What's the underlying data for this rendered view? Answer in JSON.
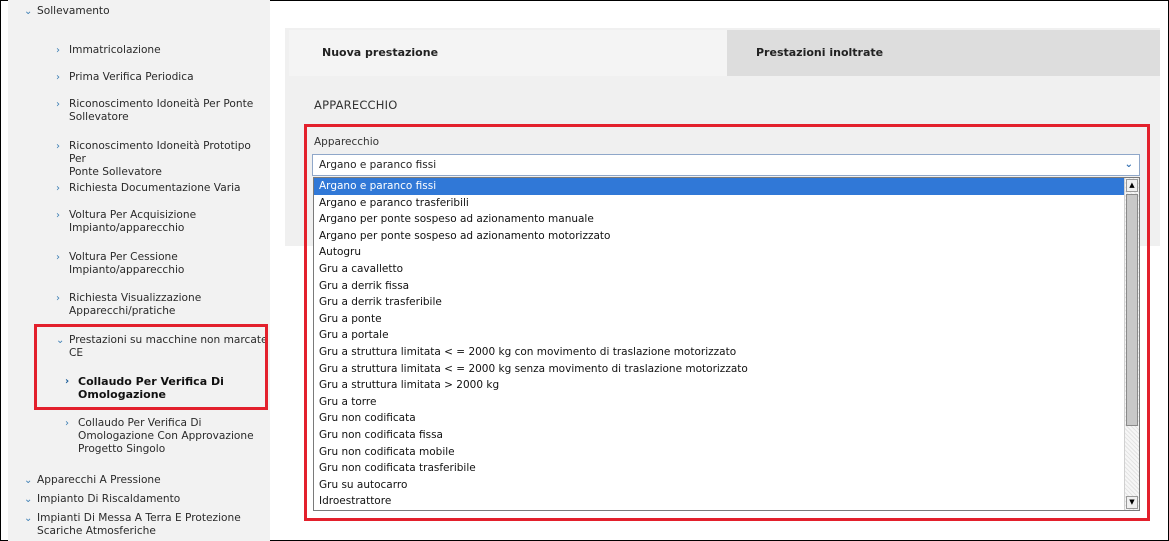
{
  "sidebar": {
    "top_group": "Sollevamento",
    "items": [
      {
        "label": "Immatricolazione"
      },
      {
        "label": "Prima Verifica Periodica"
      },
      {
        "label": "Riconoscimento Idoneità Per Ponte",
        "label2": "Sollevatore"
      },
      {
        "label": "Riconoscimento Idoneità Prototipo Per",
        "label2": "Ponte Sollevatore"
      },
      {
        "label": "Richiesta Documentazione Varia"
      },
      {
        "label": "Voltura Per Acquisizione",
        "label2": "Impianto/apparecchio"
      },
      {
        "label": "Voltura Per Cessione",
        "label2": "Impianto/apparecchio"
      },
      {
        "label": "Richiesta Visualizzazione",
        "label2": "Apparecchi/pratiche"
      }
    ],
    "subgroup": {
      "label": "Prestazioni su macchine non marcate",
      "label2": "CE"
    },
    "active_item": {
      "label": "Collaudo Per Verifica Di",
      "label2": "Omologazione"
    },
    "next_item": {
      "label": "Collaudo Per Verifica Di",
      "label2": "Omologazione Con Approvazione",
      "label3": "Progetto Singolo"
    },
    "bottom_groups": [
      {
        "label": "Apparecchi A Pressione"
      },
      {
        "label": "Impianto Di Riscaldamento"
      },
      {
        "label": "Impianti Di Messa A Terra E Protezione",
        "label2": "Scariche Atmosferiche"
      }
    ]
  },
  "tabs": {
    "new": "Nuova prestazione",
    "sent": "Prestazioni inoltrate"
  },
  "section": {
    "title": "APPARECCHIO"
  },
  "field": {
    "label": "Apparecchio",
    "value": "Argano e paranco fissi"
  },
  "options": [
    "Argano e paranco fissi",
    "Argano e paranco trasferibili",
    "Argano per ponte sospeso ad azionamento manuale",
    "Argano per ponte sospeso ad azionamento motorizzato",
    "Autogru",
    "Gru a cavalletto",
    "Gru a derrik fissa",
    "Gru a derrik trasferibile",
    "Gru a ponte",
    "Gru a portale",
    "Gru a struttura limitata < = 2000 kg con movimento di traslazione motorizzato",
    "Gru a struttura limitata < = 2000 kg senza movimento di traslazione motorizzato",
    "Gru a struttura limitata > 2000 kg",
    "Gru a torre",
    "Gru non codificata",
    "Gru non codificata fissa",
    "Gru non codificata mobile",
    "Gru non codificata trasferibile",
    "Gru su autocarro",
    "Idroestrattore"
  ],
  "selected_option_index": 0,
  "colors": {
    "highlight": "#e3202c",
    "selection": "#3078d7",
    "chevron": "#3c7fb5",
    "sidebar_bg": "#f2f2f2"
  },
  "icons": {
    "chevron_down": "chevron-down-icon",
    "chevron_right": "chevron-right-icon",
    "scroll_up": "scroll-up-arrow-icon",
    "scroll_down": "scroll-down-arrow-icon"
  }
}
